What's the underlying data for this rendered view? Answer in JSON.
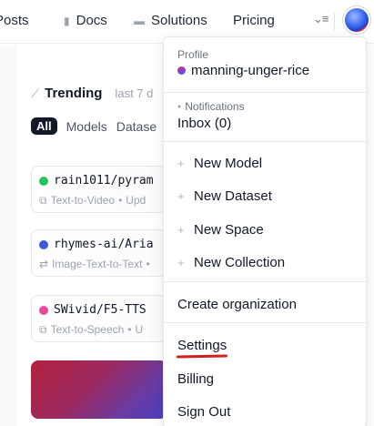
{
  "nav": {
    "items": [
      {
        "label": "Posts",
        "icon": "posts-icon"
      },
      {
        "label": "Docs",
        "icon": "docs-icon"
      },
      {
        "label": "Solutions",
        "icon": "solutions-icon"
      },
      {
        "label": "Pricing"
      }
    ],
    "more_icon": "menu-more-icon",
    "avatar": "user-avatar"
  },
  "trending": {
    "title": "Trending",
    "period": "last 7 d",
    "filters": [
      "All",
      "Models",
      "Datase"
    ]
  },
  "cards": [
    {
      "title": "rain1011/pyram",
      "dot_color": "#22c55e",
      "type": "Text-to-Video",
      "meta": "Upd"
    },
    {
      "title": "rhymes-ai/Aria",
      "dot_color": "#3b5bdb",
      "type": "Image-Text-to-Text",
      "meta": ""
    },
    {
      "title": "SWivid/F5-TTS",
      "dot_color": "#ec4899",
      "type": "Text-to-Speech",
      "meta": "U"
    }
  ],
  "menu": {
    "profile_caption": "Profile",
    "username": "manning-unger-rice",
    "notifications_caption": "Notifications",
    "inbox": "Inbox (0)",
    "new_items": [
      "New Model",
      "New Dataset",
      "New Space",
      "New Collection"
    ],
    "create_org": "Create organization",
    "settings": "Settings",
    "billing": "Billing",
    "sign_out": "Sign Out"
  },
  "colors": {
    "annotation_underline": "#d21f1f",
    "accent_dark": "#111827"
  }
}
